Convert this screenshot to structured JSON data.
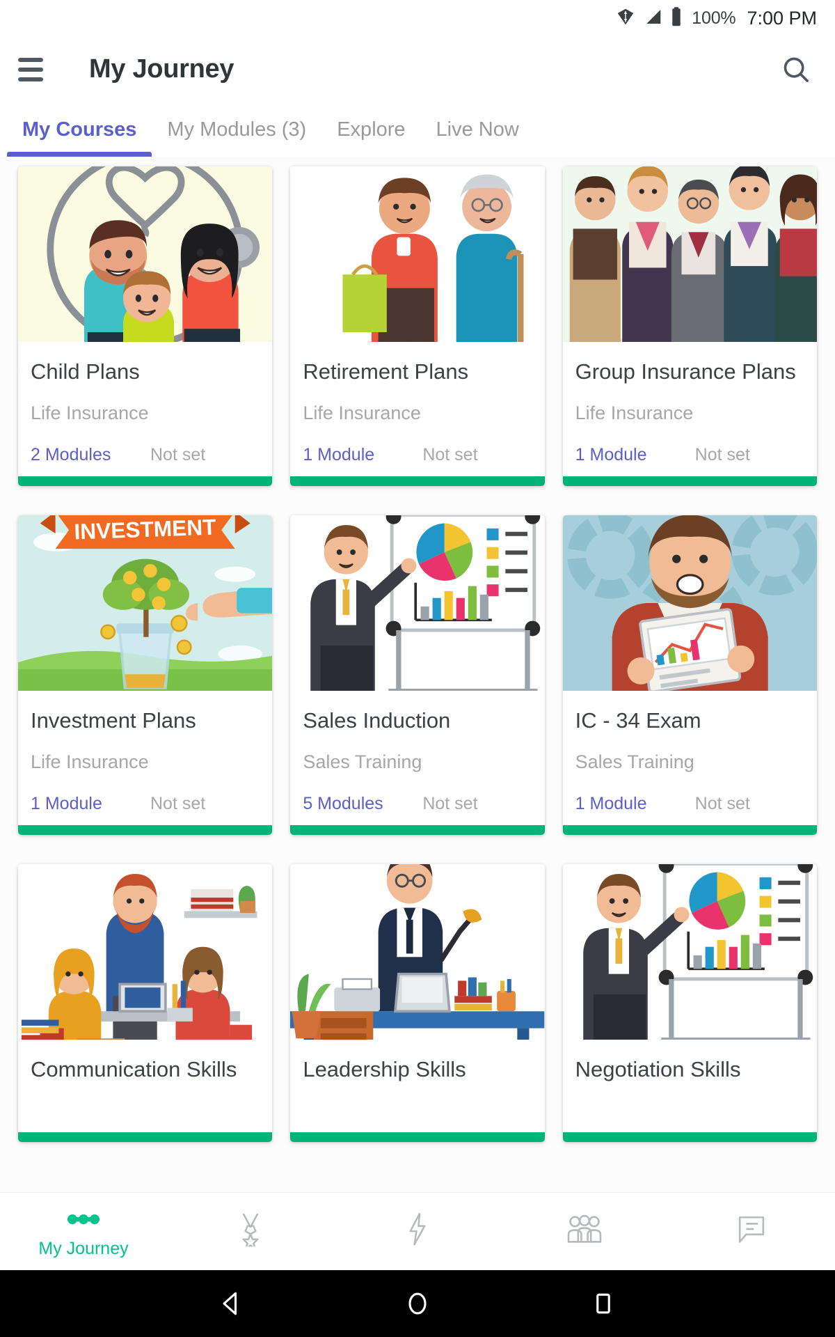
{
  "statusbar": {
    "battery_percent": "100%",
    "time": "7:00 PM",
    "wifi_icon": "wifi-icon",
    "signal_icon": "signal-icon",
    "battery_icon": "battery-icon"
  },
  "appbar": {
    "title": "My Journey",
    "menu_icon": "hamburger-menu-icon",
    "search_icon": "search-icon"
  },
  "tabs": [
    {
      "label": "My Courses",
      "active": true
    },
    {
      "label": "My Modules (3)",
      "active": false
    },
    {
      "label": "Explore",
      "active": false
    },
    {
      "label": "Live Now",
      "active": false
    }
  ],
  "colors": {
    "accent_purple": "#5b5fc7",
    "progress_green": "#00b377",
    "nav_active_green": "#00c48a",
    "muted_text": "#a7a7ab",
    "title_text": "#3c4145"
  },
  "cards": [
    {
      "title": "Child Plans",
      "category": "Life Insurance",
      "modules": "2 Modules",
      "status": "Not set",
      "image_name": "family-stethoscope-illustration",
      "image_bg": "#fafbe0"
    },
    {
      "title": "Retirement Plans",
      "category": "Life Insurance",
      "modules": "1 Module",
      "status": "Not set",
      "image_name": "caregiver-elderly-woman-illustration",
      "image_bg": "#ffffff"
    },
    {
      "title": "Group Insurance Plans",
      "category": "Life Insurance",
      "modules": "1 Module",
      "status": "Not set",
      "image_name": "business-group-people-illustration",
      "image_bg": "#eef8ef"
    },
    {
      "title": "Investment Plans",
      "category": "Life Insurance",
      "modules": "1 Module",
      "status": "Not set",
      "image_name": "money-tree-investment-illustration",
      "image_bg": "#d7f0ee"
    },
    {
      "title": "Sales Induction",
      "category": "Sales Training",
      "modules": "5 Modules",
      "status": "Not set",
      "image_name": "presenter-whiteboard-charts-illustration",
      "image_bg": "#ffffff"
    },
    {
      "title": "IC - 34 Exam",
      "category": "Sales Training",
      "modules": "1 Module",
      "status": "Not set",
      "image_name": "man-clipboard-report-illustration",
      "image_bg": "#a7cfdb"
    },
    {
      "title": "Communication Skills",
      "category": "",
      "modules": "",
      "status": "",
      "image_name": "team-discussion-table-illustration",
      "image_bg": "#ffffff"
    },
    {
      "title": "Leadership Skills",
      "category": "",
      "modules": "",
      "status": "",
      "image_name": "man-desk-laptop-illustration",
      "image_bg": "#ffffff"
    },
    {
      "title": "Negotiation Skills",
      "category": "",
      "modules": "",
      "status": "",
      "image_name": "presenter-whiteboard-charts-illustration",
      "image_bg": "#ffffff"
    }
  ],
  "bottomnav": [
    {
      "label": "My Journey",
      "icon": "journey-path-icon",
      "active": true
    },
    {
      "label": "",
      "icon": "medal-award-icon",
      "active": false
    },
    {
      "label": "",
      "icon": "lightning-bolt-icon",
      "active": false
    },
    {
      "label": "",
      "icon": "people-group-icon",
      "active": false
    },
    {
      "label": "",
      "icon": "chat-message-icon",
      "active": false
    }
  ],
  "sysnav": {
    "back_icon": "back-triangle-icon",
    "home_icon": "home-circle-icon",
    "recents_icon": "recents-square-icon"
  }
}
